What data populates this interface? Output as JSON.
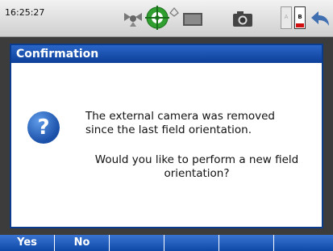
{
  "status": {
    "time": "16:25:27",
    "battery_label": "B",
    "spare_battery_label": "A",
    "icons": [
      "gps-icon",
      "target-icon",
      "radio-icon",
      "card-icon",
      "camera-icon",
      "battery-icon",
      "back-icon"
    ]
  },
  "dialog": {
    "title": "Confirmation",
    "icon": "question-icon",
    "icon_glyph": "?",
    "message": "The external camera was removed since the last field orientation.",
    "question": "Would you like to perform a new field orientation?"
  },
  "softkeys": [
    {
      "label": "Yes"
    },
    {
      "label": "No"
    },
    {
      "label": ""
    },
    {
      "label": ""
    },
    {
      "label": ""
    },
    {
      "label": ""
    }
  ],
  "colors": {
    "title_bar": "#1a4fa8",
    "softkey_bar": "#2a64c4",
    "target_green": "#2fa02f",
    "battery_red": "#d01010"
  }
}
